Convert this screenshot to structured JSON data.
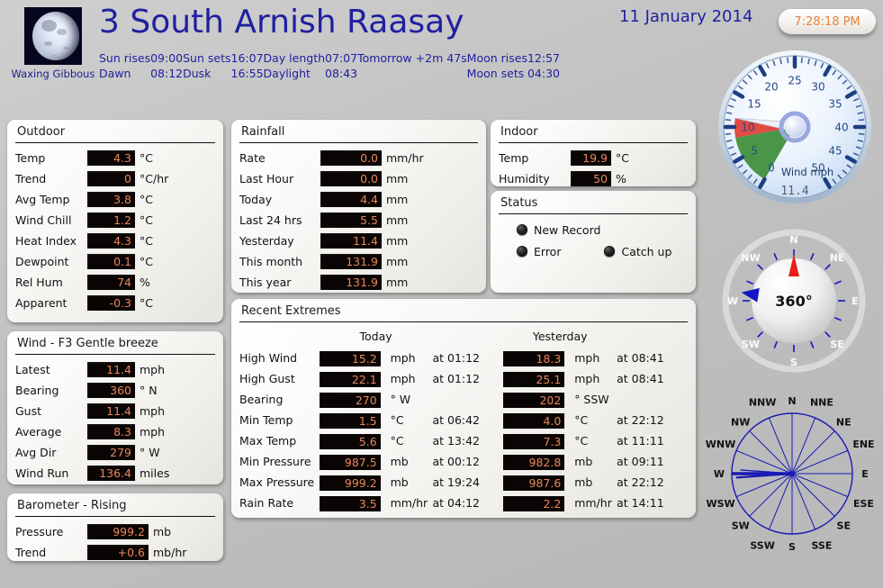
{
  "header": {
    "site_title": "3 South Arnish Raasay",
    "date": "11 January 2014",
    "clock": "7:28:18 PM",
    "moon_phase": "Waxing Gibbous",
    "astro": [
      {
        "l1": "Sun rises",
        "v1": "09:00",
        "l2": "Sun sets",
        "v2": "16:07",
        "l3": "Day length",
        "v3": "07:07",
        "l4": "Tomorrow +2m 47s",
        "l5": "Moon rises",
        "v5": "12:57"
      },
      {
        "l1": "Dawn",
        "v1": "08:12",
        "l2": "Dusk",
        "v2": "16:55",
        "l3": "Daylight",
        "v3": "08:43",
        "l4": "",
        "l5": "Moon sets",
        "v5": "04:30"
      }
    ]
  },
  "outdoor": {
    "title": "Outdoor",
    "rows": [
      {
        "label": "Temp",
        "value": "4.3",
        "unit": "°C"
      },
      {
        "label": "Trend",
        "value": "0",
        "unit": "°C/hr"
      },
      {
        "label": "Avg Temp",
        "value": "3.8",
        "unit": "°C"
      },
      {
        "label": "Wind Chill",
        "value": "1.2",
        "unit": "°C"
      },
      {
        "label": "Heat Index",
        "value": "4.3",
        "unit": "°C"
      },
      {
        "label": "Dewpoint",
        "value": "0.1",
        "unit": "°C"
      },
      {
        "label": "Rel Hum",
        "value": "74",
        "unit": "%"
      },
      {
        "label": "Apparent",
        "value": "-0.3",
        "unit": "°C"
      }
    ]
  },
  "wind": {
    "title": "Wind - F3 Gentle breeze",
    "rows": [
      {
        "label": "Latest",
        "value": "11.4",
        "unit": "mph"
      },
      {
        "label": "Bearing",
        "value": "360",
        "unit": "° N"
      },
      {
        "label": "Gust",
        "value": "11.4",
        "unit": "mph"
      },
      {
        "label": "Average",
        "value": "8.3",
        "unit": "mph"
      },
      {
        "label": "Avg Dir",
        "value": "279",
        "unit": "° W"
      },
      {
        "label": "Wind Run",
        "value": "136.4",
        "unit": "miles"
      }
    ]
  },
  "barometer": {
    "title": "Barometer - Rising",
    "rows": [
      {
        "label": "Pressure",
        "value": "999.2",
        "unit": "mb"
      },
      {
        "label": "Trend",
        "value": "+0.6",
        "unit": "mb/hr"
      }
    ]
  },
  "rainfall": {
    "title": "Rainfall",
    "rows": [
      {
        "label": "Rate",
        "value": "0.0",
        "unit": "mm/hr"
      },
      {
        "label": "Last Hour",
        "value": "0.0",
        "unit": "mm"
      },
      {
        "label": "Today",
        "value": "4.4",
        "unit": "mm"
      },
      {
        "label": "Last 24 hrs",
        "value": "5.5",
        "unit": "mm"
      },
      {
        "label": "Yesterday",
        "value": "11.4",
        "unit": "mm"
      },
      {
        "label": "This month",
        "value": "131.9",
        "unit": "mm"
      },
      {
        "label": "This year",
        "value": "131.9",
        "unit": "mm"
      }
    ]
  },
  "indoor": {
    "title": "Indoor",
    "rows": [
      {
        "label": "Temp",
        "value": "19.9",
        "unit": "°C"
      },
      {
        "label": "Humidity",
        "value": "50",
        "unit": "%"
      }
    ]
  },
  "status": {
    "title": "Status",
    "leds": [
      {
        "label": "New Record",
        "on": false
      },
      {
        "label": "Error",
        "on": false
      },
      {
        "label": "Catch up",
        "on": false
      }
    ]
  },
  "extremes": {
    "title": "Recent Extremes",
    "col_today": "Today",
    "col_yesterday": "Yesterday",
    "rows": [
      {
        "label": "High Wind",
        "t_val": "15.2",
        "t_unit": "mph",
        "t_at": "at 01:12",
        "y_val": "18.3",
        "y_unit": "mph",
        "y_at": "at 08:41"
      },
      {
        "label": "High Gust",
        "t_val": "22.1",
        "t_unit": "mph",
        "t_at": "at 01:12",
        "y_val": "25.1",
        "y_unit": "mph",
        "y_at": "at 08:41"
      },
      {
        "label": "Bearing",
        "t_val": "270",
        "t_unit": "°  W",
        "t_at": "",
        "y_val": "202",
        "y_unit": "°  SSW",
        "y_at": ""
      },
      {
        "label": "Min Temp",
        "t_val": "1.5",
        "t_unit": "°C",
        "t_at": "at 06:42",
        "y_val": "4.0",
        "y_unit": "°C",
        "y_at": "at 22:12"
      },
      {
        "label": "Max Temp",
        "t_val": "5.6",
        "t_unit": "°C",
        "t_at": "at 13:42",
        "y_val": "7.3",
        "y_unit": "°C",
        "y_at": "at 11:11"
      },
      {
        "label": "Min Pressure",
        "t_val": "987.5",
        "t_unit": "mb",
        "t_at": "at 00:12",
        "y_val": "982.8",
        "y_unit": "mb",
        "y_at": "at 09:11"
      },
      {
        "label": "Max Pressure",
        "t_val": "999.2",
        "t_unit": "mb",
        "t_at": "at 19:24",
        "y_val": "987.6",
        "y_unit": "mb",
        "y_at": "at 22:12"
      },
      {
        "label": "Rain Rate",
        "t_val": "3.5",
        "t_unit": "mm/hr",
        "t_at": "at 04:12",
        "y_val": "2.2",
        "y_unit": "mm/hr",
        "y_at": "at 14:11"
      }
    ]
  },
  "gauges": {
    "wind_speed": {
      "caption": "Wind mph",
      "readout": "11.4",
      "value": 11.4,
      "min": 0,
      "max": 50,
      "ticks": [
        "0",
        "5",
        "10",
        "15",
        "20",
        "25",
        "30",
        "35",
        "40",
        "45",
        "50"
      ],
      "average_band_max": 8.3,
      "gust_band_max": 11.4,
      "band_average_color": "#4a9648",
      "band_gust_color": "#e24a43",
      "face_color": "#e8f0fb"
    },
    "compass": {
      "value": "360°",
      "bearing": 360,
      "average_bearing": 279,
      "points": [
        "N",
        "NE",
        "E",
        "SE",
        "S",
        "SW",
        "W",
        "NW"
      ],
      "needle_color": "#e8201a",
      "average_color": "#1414c8"
    },
    "wind_rose": {
      "points": [
        "N",
        "NNE",
        "NE",
        "ENE",
        "E",
        "ESE",
        "SE",
        "SSE",
        "S",
        "SSW",
        "SW",
        "WSW",
        "W",
        "WNW",
        "NW",
        "NNW"
      ],
      "petal_color": "#1a1ab4",
      "dominant_direction": "W"
    }
  },
  "colors": {
    "title_blue": "#2020a0",
    "value_text": "#e8875a",
    "value_bg": "#0a0504",
    "clock_text": "#e8803c",
    "background": "#c4c4c4"
  }
}
